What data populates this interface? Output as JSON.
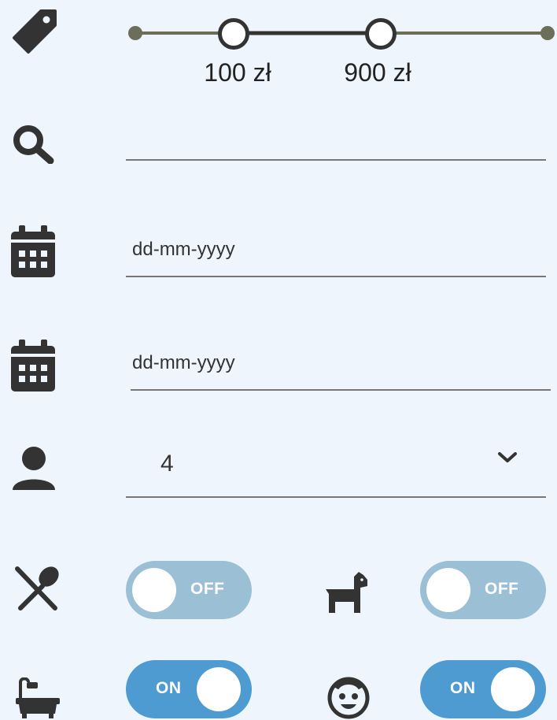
{
  "price": {
    "min_label": "100 zł",
    "max_label": "900 zł",
    "track_color": "#6b6e58",
    "active_color": "#333333"
  },
  "icons": {
    "price": "tag-icon",
    "search": "search-icon",
    "check_in": "calendar-icon",
    "check_out": "calendar-icon",
    "guests": "person-icon",
    "restaurant": "restaurant-icon",
    "pets": "dog-icon",
    "bath": "bathtub-icon",
    "kids": "child-face-icon"
  },
  "search": {
    "value": ""
  },
  "check_in": {
    "placeholder": "dd-mm-yyyy"
  },
  "check_out": {
    "placeholder": "dd-mm-yyyy"
  },
  "guests": {
    "value": "4"
  },
  "toggles": {
    "restaurant": {
      "label": "OFF",
      "state": "off"
    },
    "pets": {
      "label": "OFF",
      "state": "off"
    },
    "bath": {
      "label": "ON",
      "state": "on"
    },
    "kids": {
      "label": "ON",
      "state": "on"
    }
  },
  "colors": {
    "background": "#eef5fd",
    "toggle_off": "#9bbfd5",
    "toggle_on": "#4d9bd0"
  }
}
